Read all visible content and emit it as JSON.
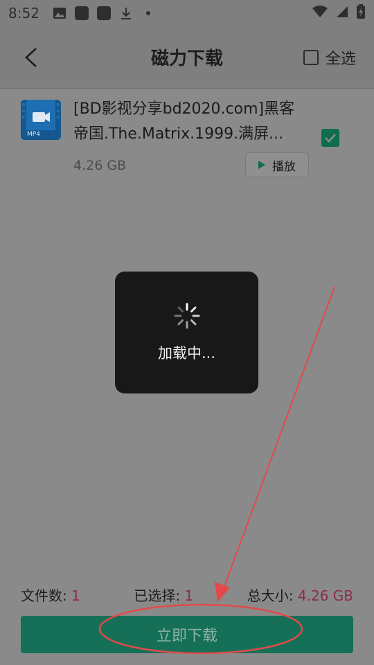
{
  "status_bar": {
    "time": "8:52",
    "icons_left": [
      "image-icon",
      "app-square-icon",
      "app-square-icon",
      "download-icon",
      "dot-icon"
    ],
    "icons_right": [
      "wifi-icon",
      "signal-icon",
      "battery-icon"
    ]
  },
  "header": {
    "title": "磁力下载",
    "select_all_label": "全选"
  },
  "file": {
    "thumb_label": "MP4",
    "title": "[BD影视分享bd2020.com]黑客帝国.The.Matrix.1999.满屏...",
    "size": "4.26 GB",
    "play_label": "播放",
    "checked": true
  },
  "loading": {
    "text": "加载中..."
  },
  "summary": {
    "files_label": "文件数: ",
    "files_value": "1",
    "selected_label": "已选择: ",
    "selected_value": "1",
    "total_label": "总大小: ",
    "total_value": "4.26 GB"
  },
  "download_button": {
    "label": "立即下载"
  },
  "colors": {
    "primary": "#167057",
    "accent_value": "#8c2b4d",
    "annotation": "#e24a4a"
  }
}
